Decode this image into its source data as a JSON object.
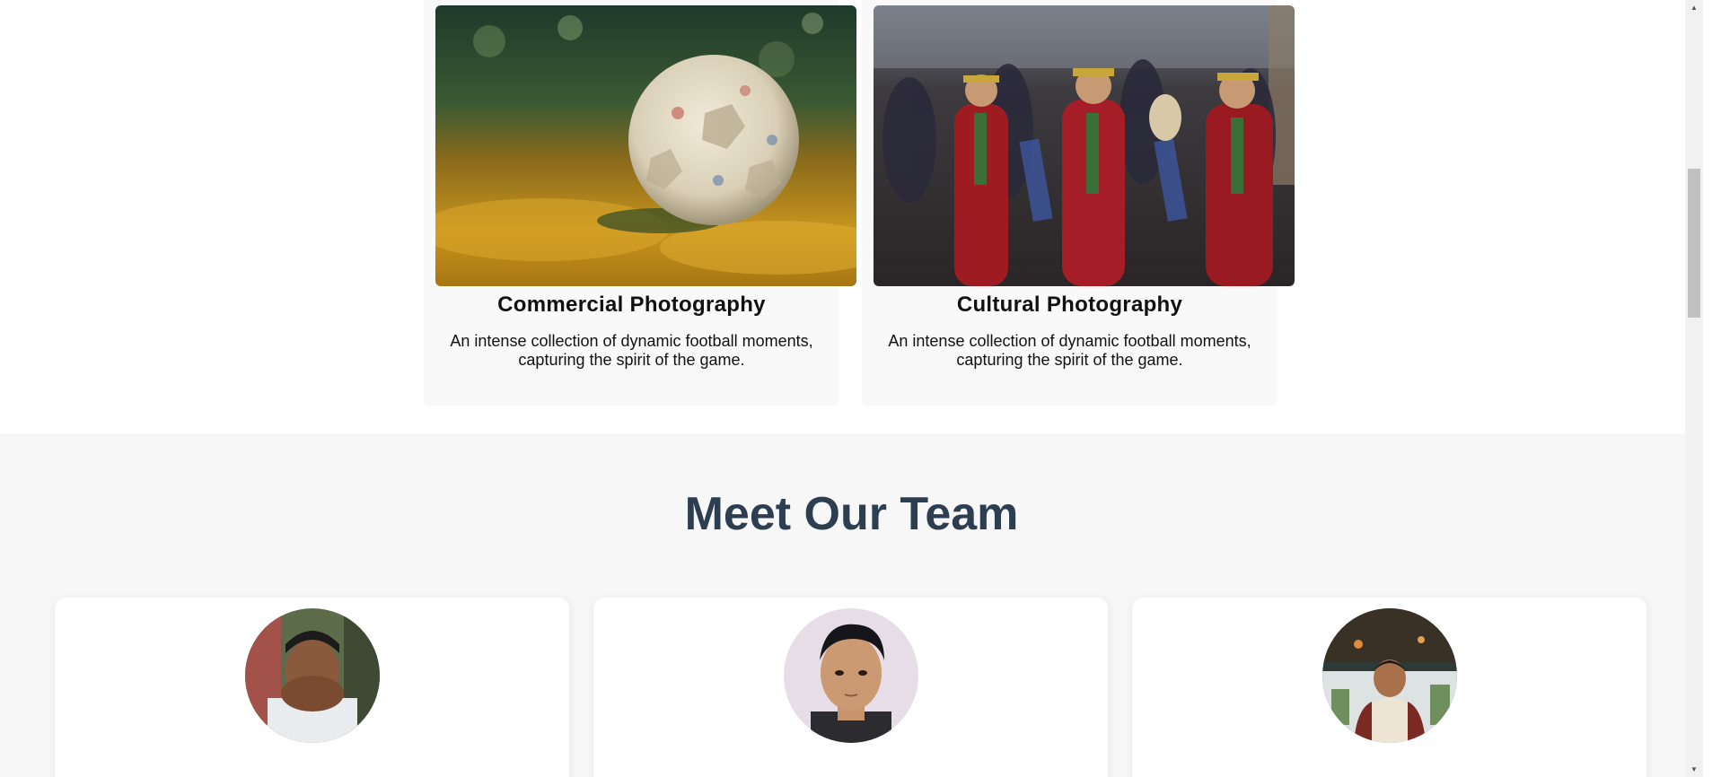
{
  "portfolio": {
    "cards": [
      {
        "title": "Commercial Photography",
        "description": "An intense collection of dynamic football moments, capturing the spirit of the game.",
        "image": "football-on-autumn-leaves-photo"
      },
      {
        "title": "Cultural Photography",
        "description": "An intense collection of dynamic football moments, capturing the spirit of the game.",
        "image": "cultural-dance-procession-photo"
      }
    ]
  },
  "team": {
    "heading": "Meet Our Team",
    "members": [
      {
        "image": "team-member-1-photo"
      },
      {
        "image": "team-member-2-photo"
      },
      {
        "image": "team-member-3-photo"
      }
    ]
  },
  "scrollbar": {
    "up_arrow": "▲",
    "down_arrow": "▼"
  },
  "colors": {
    "heading": "#2c3e50",
    "section_bg": "#f7f7f7",
    "card_bg": "#f9f9f9"
  }
}
